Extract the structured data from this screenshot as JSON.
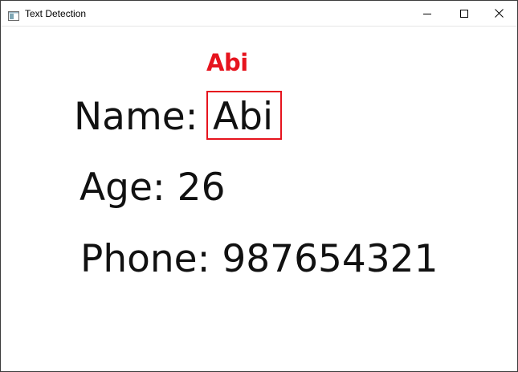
{
  "window": {
    "title": "Text Detection",
    "controls": {
      "minimize_icon": "minimize-icon",
      "maximize_icon": "maximize-icon",
      "close_icon": "close-icon"
    }
  },
  "detection": {
    "detected_text": "Abi",
    "box_color": "#e6141e"
  },
  "document": {
    "name_label": "Name:",
    "name_value": "Abi",
    "age_line": "Age: 26",
    "phone_line": "Phone: 987654321"
  }
}
